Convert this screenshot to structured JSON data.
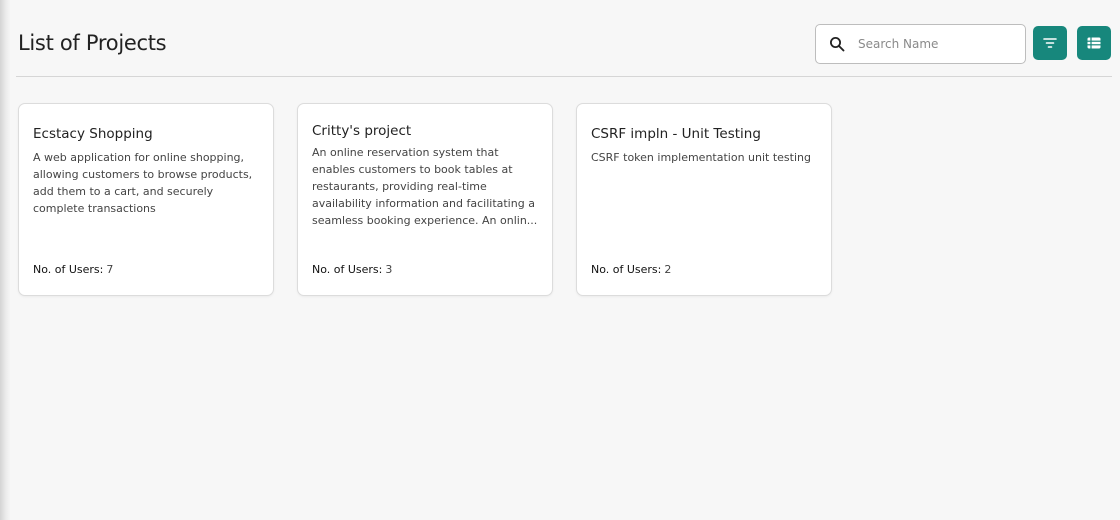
{
  "header": {
    "title": "List of Projects",
    "search": {
      "placeholder": "Search Name",
      "value": ""
    },
    "filter_icon": "filter-icon",
    "list_view_icon": "list-view-icon",
    "accent_color": "#17877c"
  },
  "projects": [
    {
      "name": "Ecstacy Shopping",
      "description": "A web application for online shopping, allowing customers to browse products, add them to a cart, and securely complete transactions",
      "users_label": "No. of Users:",
      "users_count": "7"
    },
    {
      "name": "Critty's project",
      "description": "An online reservation system that enables customers to book tables at restaurants, providing real-time availability information and facilitating a seamless booking experience. An onlin...",
      "users_label": "No. of Users:",
      "users_count": "3"
    },
    {
      "name": "CSRF impln - Unit Testing",
      "description": "CSRF token implementation unit testing",
      "users_label": "No. of Users:",
      "users_count": "2"
    }
  ]
}
